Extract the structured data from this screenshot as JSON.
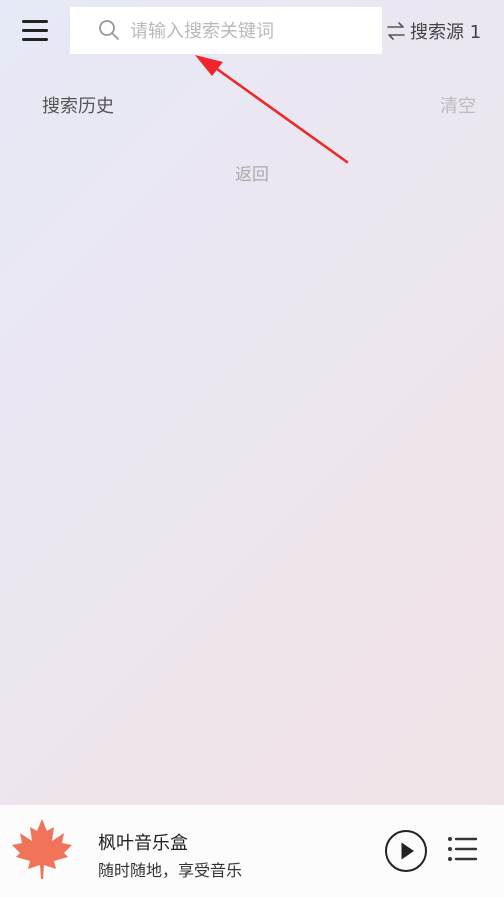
{
  "header": {
    "menu_icon": "hamburger-menu-icon",
    "search": {
      "placeholder": "请输入搜索关键词",
      "value": "",
      "icon": "search-icon"
    },
    "source": {
      "icon": "swap-arrows-icon",
      "label": "搜索源 1"
    }
  },
  "history": {
    "title": "搜索历史",
    "clear_label": "清空",
    "back_label": "返回"
  },
  "annotation": {
    "color": "#f0262a"
  },
  "player": {
    "cover_icon": "maple-leaf-icon",
    "cover_color": "#f0745a",
    "title": "枫叶音乐盒",
    "subtitle": "随时随地，享受音乐",
    "play_icon": "play-icon",
    "playlist_icon": "playlist-icon"
  }
}
